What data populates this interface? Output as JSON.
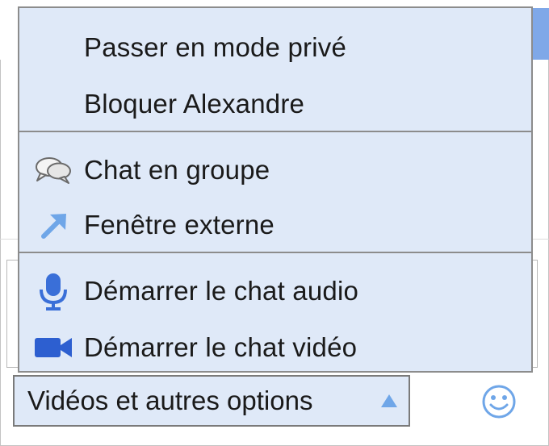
{
  "menu": {
    "items": [
      {
        "label": "Passer en mode privé",
        "icon": ""
      },
      {
        "label": "Bloquer Alexandre",
        "icon": ""
      },
      {
        "label": "Chat en groupe",
        "icon": "speech-bubbles-icon"
      },
      {
        "label": "Fenêtre externe",
        "icon": "pop-out-arrow-icon"
      },
      {
        "label": "Démarrer le chat audio",
        "icon": "microphone-icon"
      },
      {
        "label": "Démarrer le chat vidéo",
        "icon": "video-camera-icon"
      }
    ]
  },
  "options_button": {
    "label": "Vidéos et autres options",
    "icon": "triangle-up-icon"
  },
  "emoticon": {
    "icon": "smiley-icon"
  },
  "colors": {
    "menu_background": "#dfe9f8",
    "header_blue": "#7fa8e8",
    "icon_blue": "#3a6fd8"
  }
}
